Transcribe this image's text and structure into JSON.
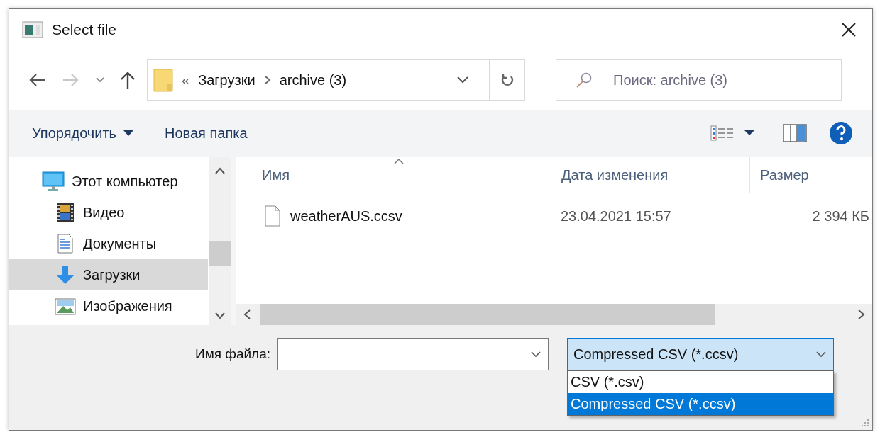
{
  "window": {
    "title": "Select file"
  },
  "address": {
    "overflow_mark": "«",
    "path": [
      {
        "label": "Загрузки"
      },
      {
        "label": "archive (3)"
      }
    ]
  },
  "search": {
    "placeholder": "Поиск: archive (3)"
  },
  "toolbar": {
    "items": [
      {
        "label": "Упорядочить",
        "dropdown": true
      },
      {
        "label": "Новая папка",
        "dropdown": false
      }
    ]
  },
  "sidebar": {
    "items": [
      {
        "label": "Этот компьютер",
        "kind": "computer",
        "selected": false,
        "children": [
          {
            "label": "Видео",
            "kind": "video",
            "selected": false
          },
          {
            "label": "Документы",
            "kind": "documents",
            "selected": false
          },
          {
            "label": "Загрузки",
            "kind": "downloads",
            "selected": true
          },
          {
            "label": "Изображения",
            "kind": "pictures",
            "selected": false
          }
        ]
      }
    ]
  },
  "table": {
    "columns": [
      {
        "label": "Имя",
        "sorted": true
      },
      {
        "label": "Дата изменения",
        "sorted": false
      },
      {
        "label": "Размер",
        "sorted": false
      }
    ],
    "rows": [
      {
        "cells": [
          "weatherAUS.ccsv",
          "23.04.2021 15:57",
          "2 394 КБ"
        ]
      }
    ]
  },
  "file_name": {
    "label": "Имя файла:"
  },
  "file_type": {
    "value": "Compressed CSV (*.ccsv)",
    "expanded": true,
    "options": [
      {
        "label": "CSV (*.csv)",
        "selected": false
      },
      {
        "label": "Compressed CSV (*.ccsv)",
        "selected": true
      }
    ]
  }
}
